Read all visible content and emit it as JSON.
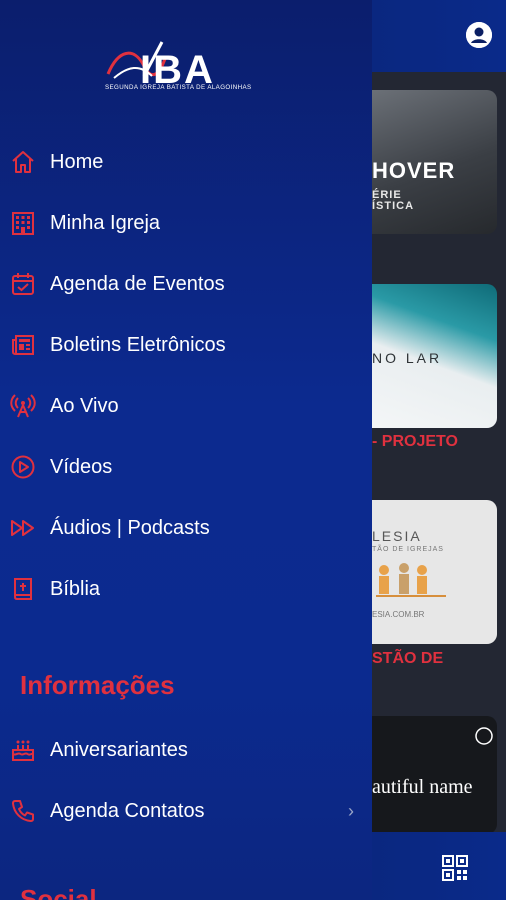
{
  "app": {
    "cards": [
      {
        "title": "HOVER",
        "sub1": "ÉRIE",
        "sub2": "ÍSTICA"
      },
      {
        "title": "NO LAR"
      },
      {
        "title": "LESIA",
        "sub": "TÃO DE IGREJAS",
        "web": "ESIA.COM.BR"
      },
      {
        "title": "autiful name"
      }
    ],
    "captions": [
      "- PROJETO",
      "STÃO DE"
    ]
  },
  "drawer": {
    "logo": {
      "text": "IBA",
      "subtitle": "SEGUNDA IGREJA BATISTA DE ALAGOINHAS"
    },
    "menu": [
      {
        "label": "Home",
        "icon": "home-icon"
      },
      {
        "label": "Minha Igreja",
        "icon": "building-icon"
      },
      {
        "label": "Agenda de Eventos",
        "icon": "calendar-check-icon"
      },
      {
        "label": "Boletins Eletrônicos",
        "icon": "newspaper-icon"
      },
      {
        "label": "Ao Vivo",
        "icon": "broadcast-icon"
      },
      {
        "label": "Vídeos",
        "icon": "play-circle-icon"
      },
      {
        "label": "Áudios | Podcasts",
        "icon": "fast-forward-icon"
      },
      {
        "label": "Bíblia",
        "icon": "bible-icon"
      }
    ],
    "section_info": "Informações",
    "info_menu": [
      {
        "label": "Aniversariantes",
        "icon": "cake-icon"
      },
      {
        "label": "Agenda Contatos",
        "icon": "phone-icon",
        "chevron": "›"
      }
    ],
    "section_next": "Social"
  },
  "colors": {
    "accent": "#e0313f",
    "drawer_bg": "#0b2a8f"
  }
}
